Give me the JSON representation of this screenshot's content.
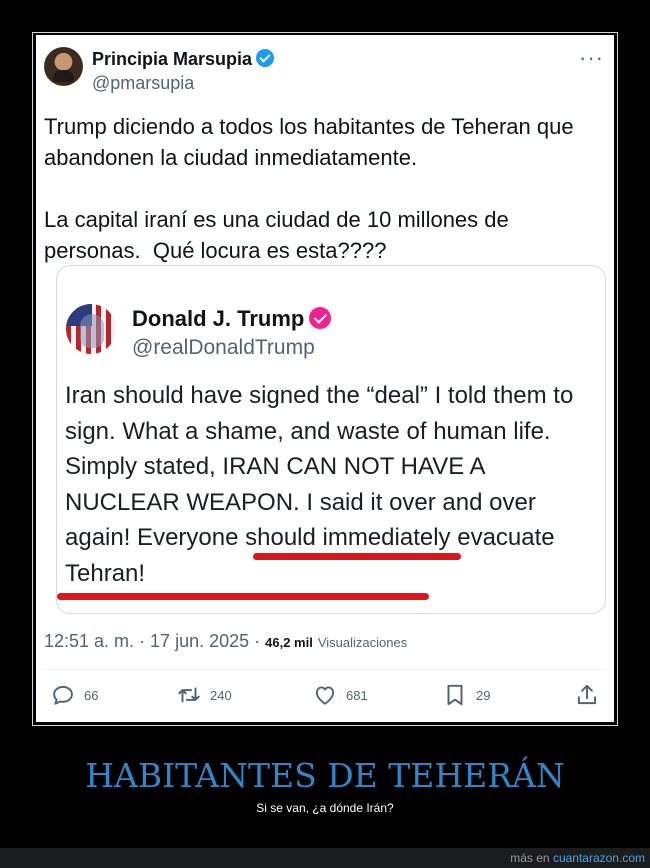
{
  "tweet": {
    "author_name": "Principia Marsupia",
    "author_handle": "@pmarsupia",
    "text": "Trump diciendo a todos los habitantes de Teheran que abandonen la ciudad inmediatamente.\n\nLa capital iraní es una ciudad de 10 millones de personas.  Qué locura es esta????",
    "more_icon": "···",
    "timestamp": "12:51 a. m. · 17 jun. 2025 · ",
    "views_count": "46,2 mil",
    "views_label": "Visualizaciones"
  },
  "quote": {
    "author_name": "Donald J. Trump",
    "author_handle": "@realDonaldTrump",
    "text": "Iran should have signed the “deal” I told them to sign. What a shame, and waste of human life. Simply stated, IRAN CAN NOT HAVE A NUCLEAR WEAPON. I said it over and over again! Everyone should immediately evacuate Tehran!"
  },
  "actions": {
    "replies": "66",
    "retweets": "240",
    "likes": "681",
    "bookmarks": "29"
  },
  "caption": {
    "headline": "HABITANTES DE TEHERÁN",
    "subline": "Si se van, ¿a dónde Irán?"
  },
  "footer": {
    "prefix": "más en ",
    "site": "cuantarazon.com"
  },
  "colors": {
    "headline": "#2f86c9",
    "verified_blue": "#1d9bf0",
    "verified_pink": "#f4208f",
    "underline_red": "#e0141b"
  },
  "icons": [
    "more-icon",
    "verified-badge-icon",
    "reply-icon",
    "retweet-icon",
    "like-icon",
    "bookmark-icon",
    "share-icon"
  ]
}
